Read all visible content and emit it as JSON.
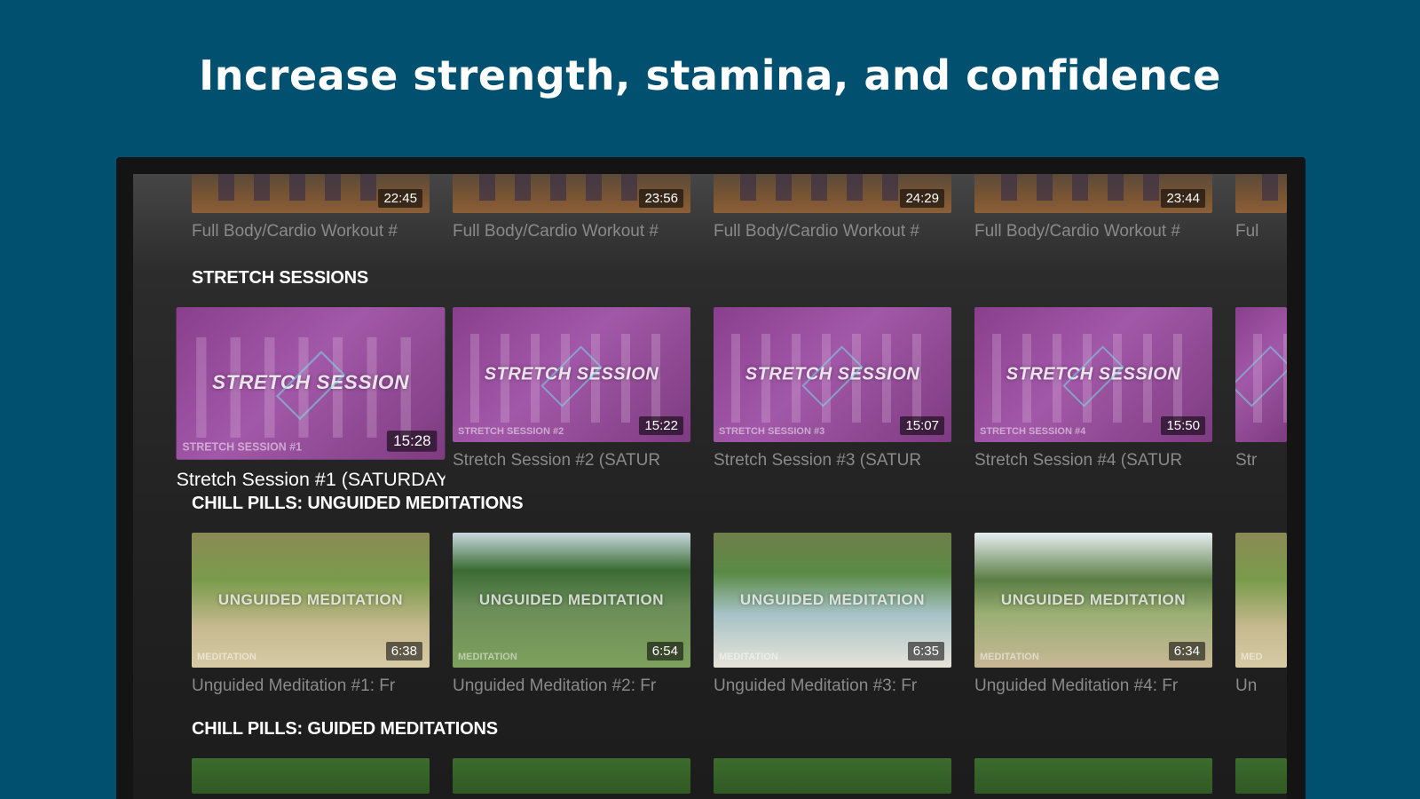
{
  "headline": "Increase strength, stamina, and confidence",
  "rows": {
    "workout": {
      "cards": [
        {
          "duration": "22:45",
          "caption": "Full Body/Cardio Workout #"
        },
        {
          "duration": "23:56",
          "caption": "Full Body/Cardio Workout #"
        },
        {
          "duration": "24:29",
          "caption": "Full Body/Cardio Workout #"
        },
        {
          "duration": "23:44",
          "caption": "Full Body/Cardio Workout #"
        },
        {
          "caption": "Ful"
        }
      ]
    },
    "stretch": {
      "title": "STRETCH SESSIONS",
      "cards": [
        {
          "overlay": "STRETCH SESSION",
          "corner": "STRETCH SESSION #1",
          "duration": "15:28",
          "caption": "Stretch Session #1 (SATURDAY"
        },
        {
          "overlay": "STRETCH SESSION",
          "corner": "STRETCH SESSION #2",
          "duration": "15:22",
          "caption": "Stretch Session #2 (SATUR"
        },
        {
          "overlay": "STRETCH SESSION",
          "corner": "STRETCH SESSION #3",
          "duration": "15:07",
          "caption": "Stretch Session #3 (SATUR"
        },
        {
          "overlay": "STRETCH SESSION",
          "corner": "STRETCH SESSION #4",
          "duration": "15:50",
          "caption": "Stretch Session #4 (SATUR"
        },
        {
          "caption": "Str"
        }
      ]
    },
    "unguided": {
      "title": "CHILL PILLS: UNGUIDED MEDITATIONS",
      "cards": [
        {
          "overlay": "UNGUIDED MEDITATION",
          "corner": "MEDITATION",
          "duration": "6:38",
          "caption": "Unguided Meditation #1: Fr"
        },
        {
          "overlay": "UNGUIDED MEDITATION",
          "corner": "MEDITATION",
          "duration": "6:54",
          "caption": "Unguided Meditation #2: Fr"
        },
        {
          "overlay": "UNGUIDED MEDITATION",
          "corner": "MEDITATION",
          "duration": "6:35",
          "caption": "Unguided Meditation #3: Fr"
        },
        {
          "overlay": "UNGUIDED MEDITATION",
          "corner": "MEDITATION",
          "duration": "6:34",
          "caption": "Unguided Meditation #4: Fr"
        },
        {
          "corner": "MED",
          "caption": "Un"
        }
      ]
    },
    "guided": {
      "title": "CHILL PILLS: GUIDED MEDITATIONS"
    }
  }
}
